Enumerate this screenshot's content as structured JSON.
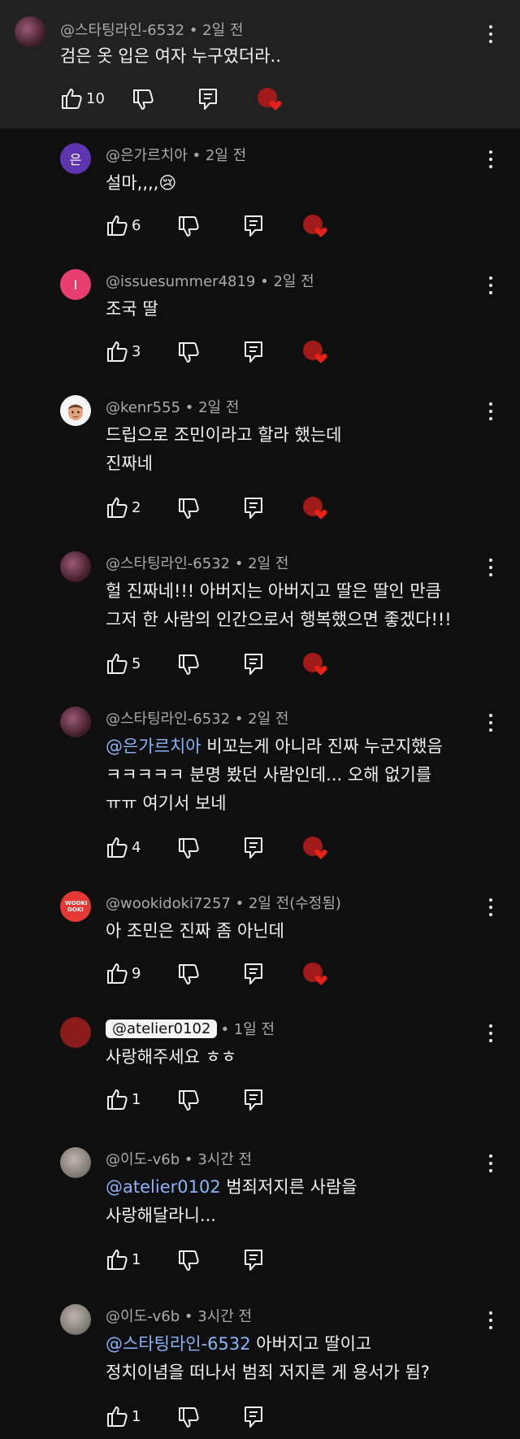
{
  "colors": {
    "background": "#0f0f0f",
    "top_background": "#212121",
    "mention": "#8ab4f8",
    "heart": "#e62117",
    "meta": "#aaaaaa"
  },
  "icons": {
    "like": "thumbs-up-icon",
    "dislike": "thumbs-down-icon",
    "reply": "reply-icon",
    "creator_heart": "creator-heart-icon",
    "more": "more-vert-icon"
  },
  "comments": [
    {
      "meta": "@스타팅라인-6532 • 2일 전",
      "lines": [
        "검은 옷 입은 여자 누구였더라.."
      ],
      "likes": "10",
      "hearted": true
    },
    {
      "avatar_letter": "은",
      "meta": "@은가르치아 • 2일 전",
      "lines": [
        "설마,,,,😢"
      ],
      "likes": "6",
      "hearted": true
    },
    {
      "avatar_letter": "I",
      "meta": "@issuesummer4819 • 2일 전",
      "lines": [
        "조국 딸"
      ],
      "likes": "3",
      "hearted": true
    },
    {
      "meta": "@kenr555 • 2일 전",
      "lines": [
        "드립으로 조민이라고 할라 했는데",
        "진짜네"
      ],
      "likes": "2",
      "hearted": true
    },
    {
      "meta": "@스타팅라인-6532 • 2일 전",
      "lines": [
        "헐 진짜네!!! 아버지는 아버지고 딸은 딸인 만큼",
        "그저 한 사람의 인간으로서 행복했으면 좋겠다!!!"
      ],
      "likes": "5",
      "hearted": true
    },
    {
      "meta": "@스타팅라인-6532 • 2일 전",
      "mention": "@은가르치아",
      "first_rest": " 비꼬는게 아니라 진짜 누군지했음",
      "lines": [
        "ㅋㅋㅋㅋㅋ 분명 봤던 사람인데... 오해 없기를",
        "ㅠㅠ 여기서 보네"
      ],
      "likes": "4",
      "hearted": true
    },
    {
      "avatar_text": "WOOKI DOKI",
      "meta": "@wookidoki7257 • 2일 전(수정됨)",
      "lines": [
        "아 조민은 진짜 좀 아닌데"
      ],
      "likes": "9",
      "hearted": true
    },
    {
      "chip": "@atelier0102",
      "meta": "• 1일 전",
      "lines": [
        "사랑해주세요 ㅎㅎ"
      ],
      "likes": "1",
      "hearted": false
    },
    {
      "meta": "@이도-v6b • 3시간 전",
      "mention": "@atelier0102",
      "first_rest": " 범죄저지른 사람을",
      "lines": [
        "사랑해달라니..."
      ],
      "likes": "1",
      "hearted": false
    },
    {
      "meta": "@이도-v6b • 3시간 전",
      "mention": "@스타팅라인-6532",
      "first_rest": " 아버지고 딸이고",
      "lines": [
        "정치이념을 떠나서 범죄 저지른 게 용서가 됨?"
      ],
      "likes": "1",
      "hearted": false
    }
  ]
}
